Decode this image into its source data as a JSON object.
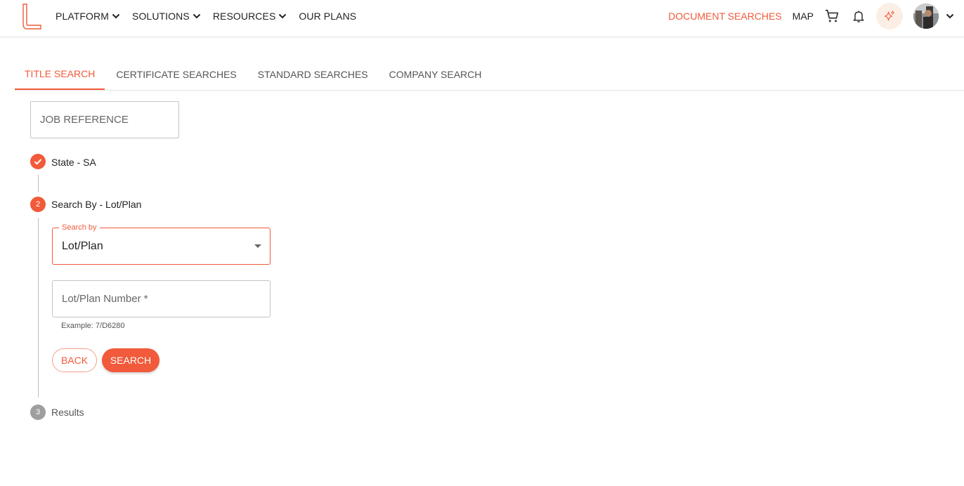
{
  "header": {
    "nav": [
      {
        "label": "PLATFORM",
        "has_dropdown": true
      },
      {
        "label": "SOLUTIONS",
        "has_dropdown": true
      },
      {
        "label": "RESOURCES",
        "has_dropdown": true
      },
      {
        "label": "OUR PLANS",
        "has_dropdown": false
      }
    ],
    "document_searches": "DOCUMENT SEARCHES",
    "map": "MAP",
    "icons": [
      "cart-icon",
      "bell-icon",
      "sparkle-icon",
      "avatar",
      "chevron-down-icon"
    ]
  },
  "tabs": [
    {
      "label": "TITLE SEARCH",
      "active": true
    },
    {
      "label": "CERTIFICATE SEARCHES",
      "active": false
    },
    {
      "label": "STANDARD SEARCHES",
      "active": false
    },
    {
      "label": "COMPANY SEARCH",
      "active": false
    }
  ],
  "job_reference": {
    "placeholder": "JOB REFERENCE",
    "value": ""
  },
  "steps": [
    {
      "label": "State - SA",
      "status": "completed"
    },
    {
      "label": "Search By - Lot/Plan",
      "number": "2",
      "status": "active"
    },
    {
      "label": "Results",
      "number": "3",
      "status": "pending"
    }
  ],
  "search_by": {
    "label": "Search by",
    "value": "Lot/Plan"
  },
  "lot_plan": {
    "placeholder": "Lot/Plan Number *",
    "value": "",
    "helper": "Example: 7/D6280"
  },
  "buttons": {
    "back": "BACK",
    "search": "SEARCH"
  },
  "colors": {
    "accent": "#f15a3a",
    "pending": "#9e9e9e"
  }
}
